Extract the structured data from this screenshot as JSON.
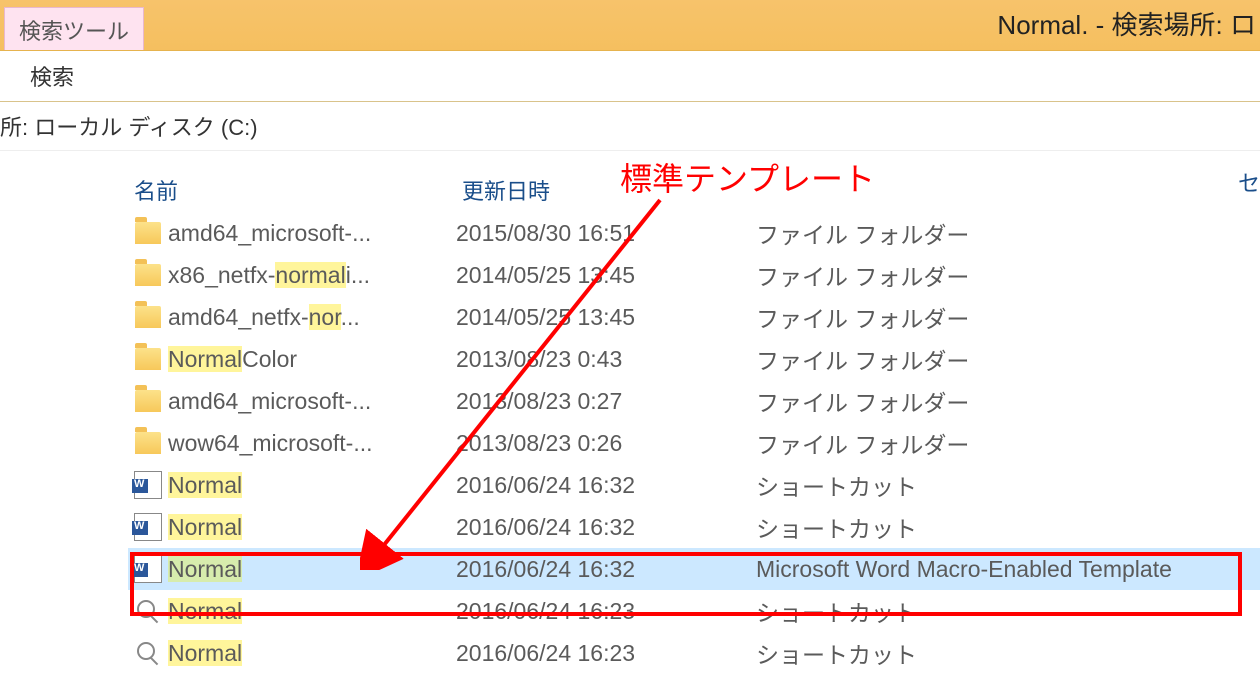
{
  "ribbon": {
    "context_tab": "検索ツール",
    "search_tab": "検索"
  },
  "title": "Normal. - 検索場所: ロ",
  "breadcrumb": "所: ローカル ディスク (C:)",
  "columns": {
    "name": "名前",
    "date": "更新日時",
    "type_cut": "セ"
  },
  "callout": "標準テンプレート",
  "rows": [
    {
      "icon": "folder",
      "name_pre": "amd64_microsoft-...",
      "hl": "",
      "date": "2015/08/30 16:51",
      "type": "ファイル フォルダー"
    },
    {
      "icon": "folder",
      "name_pre": "x86_netfx-",
      "hl": "normal",
      "name_post": "i...",
      "date": "2014/05/25 13:45",
      "type": "ファイル フォルダー"
    },
    {
      "icon": "folder",
      "name_pre": "amd64_netfx-",
      "hl": "nor",
      "name_post": "...",
      "date": "2014/05/25 13:45",
      "type": "ファイル フォルダー"
    },
    {
      "icon": "folder",
      "name_pre": "",
      "hl": "Normal",
      "name_post": "Color",
      "date": "2013/08/23 0:43",
      "type": "ファイル フォルダー"
    },
    {
      "icon": "folder",
      "name_pre": "amd64_microsoft-...",
      "hl": "",
      "date": "2013/08/23 0:27",
      "type": "ファイル フォルダー"
    },
    {
      "icon": "folder",
      "name_pre": "wow64_microsoft-...",
      "hl": "",
      "date": "2013/08/23 0:26",
      "type": "ファイル フォルダー"
    },
    {
      "icon": "word",
      "name_pre": "",
      "hl": "Normal",
      "name_post": "",
      "date": "2016/06/24 16:32",
      "type": "ショートカット"
    },
    {
      "icon": "word",
      "name_pre": "",
      "hl": "Normal",
      "name_post": "",
      "date": "2016/06/24 16:32",
      "type": "ショートカット"
    },
    {
      "icon": "word",
      "name_pre": "",
      "hl": "Normal",
      "name_post": "",
      "date": "2016/06/24 16:32",
      "type": "Microsoft Word Macro-Enabled Template",
      "selected": true
    },
    {
      "icon": "mag",
      "name_pre": "",
      "hl": "Normal",
      "name_post": "",
      "date": "2016/06/24 16:23",
      "type": "ショートカット"
    },
    {
      "icon": "mag",
      "name_pre": "",
      "hl": "Normal",
      "name_post": "",
      "date": "2016/06/24 16:23",
      "type": "ショートカット"
    }
  ]
}
